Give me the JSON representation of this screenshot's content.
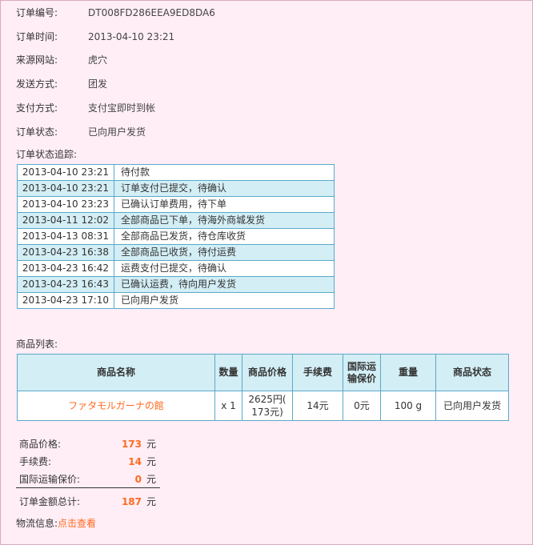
{
  "order": [
    {
      "label": "订单编号:",
      "value": "DT008FD286EEA9ED8DA6"
    },
    {
      "label": "订单时间:",
      "value": "2013-04-10 23:21"
    },
    {
      "label": "来源网站:",
      "value": "虎穴"
    },
    {
      "label": "发送方式:",
      "value": "团发"
    },
    {
      "label": "支付方式:",
      "value": "支付宝即时到帐"
    },
    {
      "label": "订单状态:",
      "value": "已向用户发货"
    }
  ],
  "tracking": {
    "label": "订单状态追踪:",
    "rows": [
      {
        "date": "2013-04-10 23:21",
        "status": "待付款"
      },
      {
        "date": "2013-04-10 23:21",
        "status": "订单支付已提交，待确认"
      },
      {
        "date": "2013-04-10 23:23",
        "status": "已确认订单费用，待下单"
      },
      {
        "date": "2013-04-11 12:02",
        "status": "全部商品已下单，待海外商城发货"
      },
      {
        "date": "2013-04-13 08:31",
        "status": "全部商品已发货，待仓库收货"
      },
      {
        "date": "2013-04-23 16:38",
        "status": "全部商品已收货，待付运费"
      },
      {
        "date": "2013-04-23 16:42",
        "status": "运费支付已提交，待确认"
      },
      {
        "date": "2013-04-23 16:43",
        "status": "已确认运费，待向用户发货"
      },
      {
        "date": "2013-04-23 17:10",
        "status": "已向用户发货"
      }
    ]
  },
  "goods": {
    "label": "商品列表:",
    "headers": {
      "name": "商品名称",
      "qty": "数量",
      "price": "商品价格",
      "fee": "手续费",
      "insurance_1": "国际运",
      "insurance_2": "输保价",
      "weight": "重量",
      "status": "商品状态"
    },
    "items": [
      {
        "name": "ファタモルガーナの館",
        "qty": "x 1",
        "price_1": "2625円(",
        "price_2": "173元)",
        "fee": "14元",
        "insurance": "0元",
        "weight": "100 g",
        "status": "已向用户发货"
      }
    ]
  },
  "summary": {
    "goods_price": {
      "label": "商品价格:",
      "value": "173",
      "unit": "元"
    },
    "service_fee": {
      "label": "手续费:",
      "value": "14",
      "unit": "元"
    },
    "insurance": {
      "label": "国际运输保价:",
      "value": "0",
      "unit": "元"
    },
    "total": {
      "label": "订单金额总计:",
      "value": "187",
      "unit": "元"
    }
  },
  "logistics": {
    "label": "物流信息:",
    "link": "点击查看"
  },
  "colors": {
    "background": "#ffeef6",
    "accent": "#ff6a1f",
    "table_header": "#d3eef5",
    "border": "#5aa9c9"
  }
}
